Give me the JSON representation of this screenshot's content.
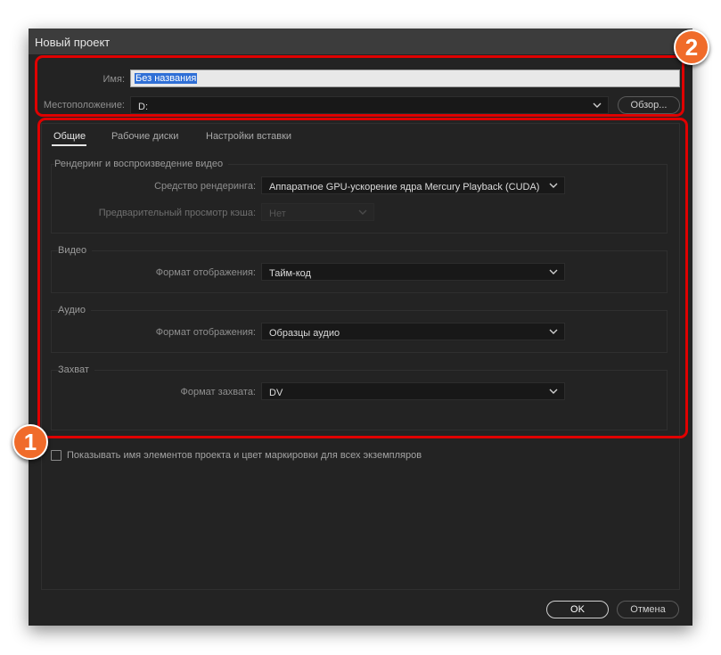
{
  "dialog": {
    "title": "Новый проект"
  },
  "project": {
    "name_label": "Имя:",
    "name_value": "Без названия",
    "location_label": "Местоположение:",
    "location_value": "D:",
    "browse_label": "Обзор..."
  },
  "tabs": [
    {
      "label": "Общие",
      "active": true
    },
    {
      "label": "Рабочие диски",
      "active": false
    },
    {
      "label": "Настройки вставки",
      "active": false
    }
  ],
  "groups": {
    "rendering": {
      "title": "Рендеринг и воспроизведение видео",
      "renderer_label": "Средство рендеринга:",
      "renderer_value": "Аппаратное GPU-ускорение ядра Mercury Playback (CUDA)",
      "preview_cache_label": "Предварительный просмотр кэша:",
      "preview_cache_value": "Нет"
    },
    "video": {
      "title": "Видео",
      "display_format_label": "Формат отображения:",
      "display_format_value": "Тайм-код"
    },
    "audio": {
      "title": "Аудио",
      "display_format_label": "Формат отображения:",
      "display_format_value": "Образцы аудио"
    },
    "capture": {
      "title": "Захват",
      "capture_format_label": "Формат захвата:",
      "capture_format_value": "DV"
    }
  },
  "checkbox": {
    "label": "Показывать имя элементов проекта и цвет маркировки для всех экземпляров",
    "checked": false
  },
  "buttons": {
    "ok": "OK",
    "cancel": "Отмена"
  },
  "annotations": {
    "badge_1": "1",
    "badge_2": "2",
    "highlight_color": "#e00000",
    "badge_color": "#f06b2a"
  }
}
